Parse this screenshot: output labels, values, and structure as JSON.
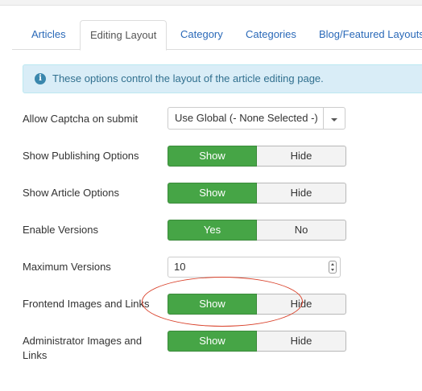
{
  "tabs": [
    {
      "label": "Articles"
    },
    {
      "label": "Editing Layout"
    },
    {
      "label": "Category"
    },
    {
      "label": "Categories"
    },
    {
      "label": "Blog/Featured Layouts"
    }
  ],
  "active_tab": "Editing Layout",
  "alert": {
    "icon": "info-icon",
    "text": "These options control the layout of the article editing page."
  },
  "fields": {
    "captcha": {
      "label": "Allow Captcha on submit",
      "value": "Use Global (- None Selected -)"
    },
    "publishing": {
      "label": "Show Publishing Options",
      "on": "Show",
      "off": "Hide"
    },
    "article_options": {
      "label": "Show Article Options",
      "on": "Show",
      "off": "Hide"
    },
    "versions": {
      "label": "Enable Versions",
      "on": "Yes",
      "off": "No"
    },
    "max_versions": {
      "label": "Maximum Versions",
      "value": "10"
    },
    "frontend_images": {
      "label": "Frontend Images and Links",
      "on": "Show",
      "off": "Hide"
    },
    "admin_images": {
      "label": "Administrator Images and Links",
      "on": "Show",
      "off": "Hide"
    }
  },
  "colors": {
    "active_green": "#46a546",
    "link_blue": "#2a69b8",
    "alert_bg": "#d9edf7",
    "annotation_red": "#d9412a"
  }
}
